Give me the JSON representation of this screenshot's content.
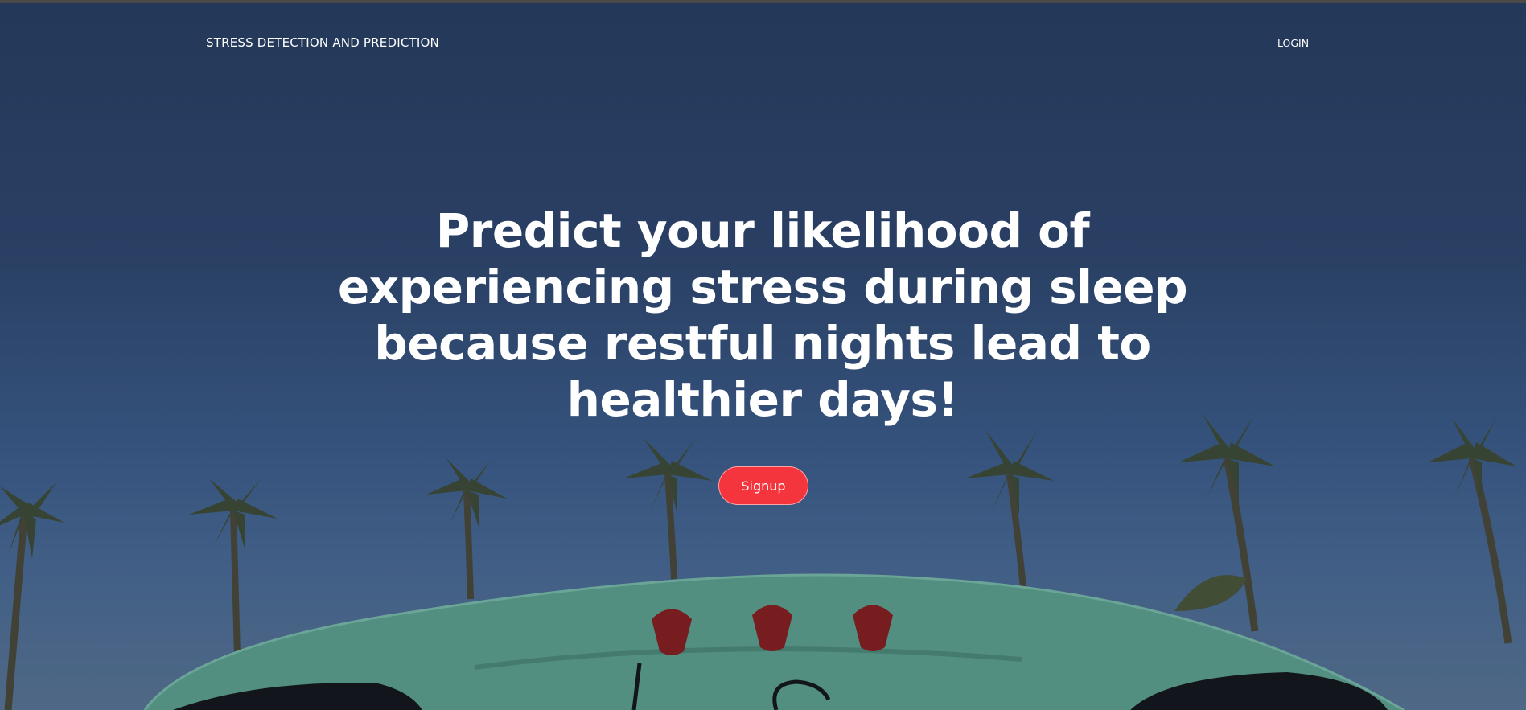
{
  "nav": {
    "brand": "STRESS DETECTION AND PREDICTION",
    "login": "LOGIN"
  },
  "hero": {
    "lines": [
      "Predict your likelihood of",
      "experiencing stress during sleep",
      "because restful nights lead to",
      "healthier days!"
    ],
    "cta_label": "Signup"
  },
  "colors": {
    "cta_background": "#f5353d",
    "sky": "#2d4468",
    "car_body": "#5fa58c",
    "taillight": "#8b1a16"
  },
  "icons": [
    "palm-tree-icon",
    "car-taillight-icon"
  ]
}
